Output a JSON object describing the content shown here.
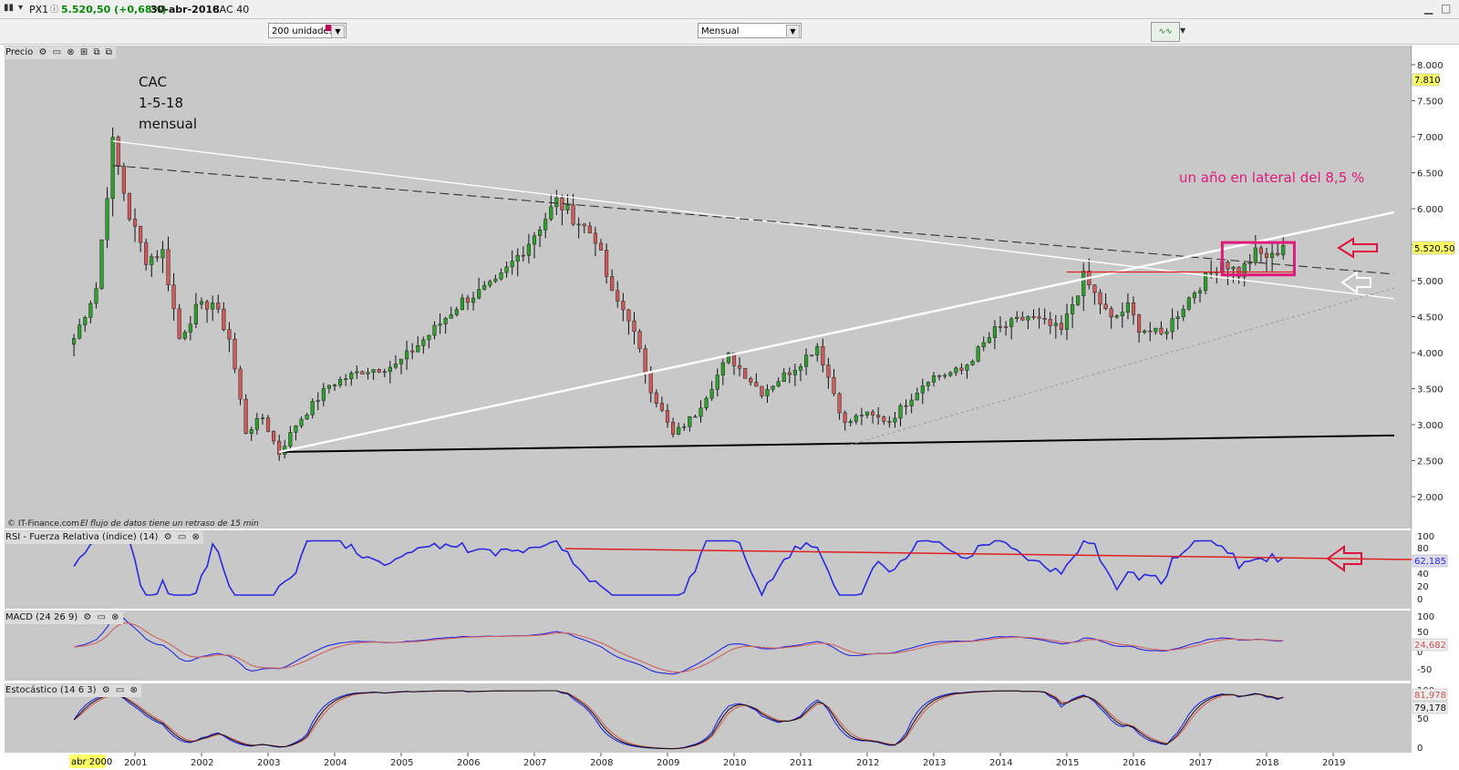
{
  "titlebar": {
    "symbol": "PX1",
    "price": "5.520,50 (+0,68%)",
    "date": "30-abr-2018",
    "name": "CAC 40"
  },
  "toolbar": {
    "units_value": "200 unidades",
    "period_value": "Mensual"
  },
  "panels": {
    "price": {
      "label": "Precio"
    },
    "rsi": {
      "label": "RSI - Fuerza Relativa (índice) (14)",
      "value_tag": "62,185"
    },
    "macd": {
      "label": "MACD (24 26 9)",
      "value_tag": "24,682"
    },
    "stoch": {
      "label": "Estocástico (14 6 3)",
      "value_tag1": "81,978",
      "value_tag2": "79,178"
    }
  },
  "colors": {
    "up": "#2ea02e",
    "down": "#d05a5a",
    "background": "#c8c8c8",
    "annotation": "#e0187a",
    "rsi_line": "#2828e0",
    "macd_signal": "#d06060",
    "tag_yellow": "#ffff66"
  },
  "annotations": {
    "label_line1": "CAC",
    "label_line2": "1-5-18",
    "label_line3": "mensual",
    "lateral": "un año en lateral del 8,5 %",
    "credit": "© IT-Finance.com",
    "delay": "El flujo de datos tiene un retraso de 15 min"
  },
  "chart_data": {
    "type": "candlestick",
    "frequency": "monthly",
    "x_axis": {
      "ticks": [
        "2001",
        "2002",
        "2003",
        "2004",
        "2005",
        "2006",
        "2007",
        "2008",
        "2009",
        "2010",
        "2011",
        "2012",
        "2013",
        "2014",
        "2015",
        "2016",
        "2017",
        "2018",
        "2019"
      ],
      "cursor_label": "abr 2000"
    },
    "y_axis": {
      "ticks": [
        "2.000",
        "2.500",
        "3.000",
        "3.500",
        "4.000",
        "4.500",
        "5.000",
        "5.500",
        "6.000",
        "6.500",
        "7.000",
        "7.500",
        "8.000"
      ],
      "ylim": [
        1700,
        8300
      ],
      "last_price_tag": "5.520,50",
      "tag_high": "7.810"
    },
    "anchors": [
      [
        "2000-02",
        4200
      ],
      [
        "2000-06",
        4900
      ],
      [
        "2000-09",
        6900
      ],
      [
        "2000-12",
        5900
      ],
      [
        "2001-03",
        5300
      ],
      [
        "2001-06",
        5400
      ],
      [
        "2001-09",
        4200
      ],
      [
        "2001-12",
        4600
      ],
      [
        "2002-03",
        4700
      ],
      [
        "2002-06",
        4200
      ],
      [
        "2002-09",
        2900
      ],
      [
        "2002-12",
        3100
      ],
      [
        "2003-03",
        2600
      ],
      [
        "2003-06",
        3000
      ],
      [
        "2003-12",
        3550
      ],
      [
        "2004-06",
        3750
      ],
      [
        "2004-12",
        3820
      ],
      [
        "2005-06",
        4250
      ],
      [
        "2005-12",
        4720
      ],
      [
        "2006-06",
        4950
      ],
      [
        "2006-12",
        5540
      ],
      [
        "2007-05",
        6100
      ],
      [
        "2007-12",
        5600
      ],
      [
        "2008-03",
        4800
      ],
      [
        "2008-06",
        4500
      ],
      [
        "2008-10",
        3500
      ],
      [
        "2009-02",
        2850
      ],
      [
        "2009-06",
        3150
      ],
      [
        "2009-12",
        3950
      ],
      [
        "2010-06",
        3450
      ],
      [
        "2010-12",
        3800
      ],
      [
        "2011-04",
        4100
      ],
      [
        "2011-09",
        3000
      ],
      [
        "2011-12",
        3150
      ],
      [
        "2012-05",
        3050
      ],
      [
        "2012-12",
        3650
      ],
      [
        "2013-06",
        3750
      ],
      [
        "2013-12",
        4300
      ],
      [
        "2014-06",
        4500
      ],
      [
        "2014-12",
        4300
      ],
      [
        "2015-04",
        5050
      ],
      [
        "2015-09",
        4450
      ],
      [
        "2015-12",
        4630
      ],
      [
        "2016-02",
        4350
      ],
      [
        "2016-06",
        4240
      ],
      [
        "2016-12",
        4860
      ],
      [
        "2017-05",
        5280
      ],
      [
        "2017-08",
        5100
      ],
      [
        "2017-11",
        5380
      ],
      [
        "2018-02",
        5320
      ],
      [
        "2018-04",
        5520
      ]
    ],
    "lines": {
      "resistance_from_2000_high": [
        [
          "2000-09",
          6940
        ],
        [
          "2019-12",
          4750
        ]
      ],
      "dashed_resistance": [
        [
          "2000-09",
          6600
        ],
        [
          "2019-12",
          5090
        ]
      ],
      "support": [
        [
          "2003-03",
          2620
        ],
        [
          "2019-12",
          2850
        ]
      ],
      "rising_trend": [
        [
          "2003-03",
          2620
        ],
        [
          "2019-12",
          5950
        ]
      ],
      "dotted_trend": [
        [
          "2011-09",
          2700
        ],
        [
          "2019-12",
          4900
        ]
      ],
      "breakout_level": [
        [
          "2015-01",
          5120
        ],
        [
          "2018-06",
          5120
        ]
      ]
    },
    "box": {
      "from": "2017-05",
      "to": "2018-06",
      "low": 5080,
      "high": 5530
    }
  }
}
